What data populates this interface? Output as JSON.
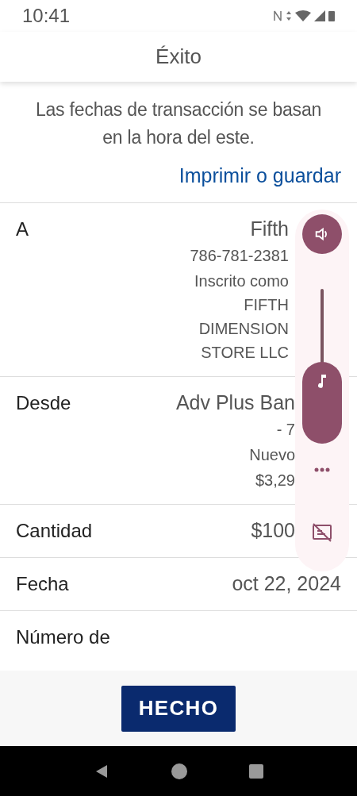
{
  "status_bar": {
    "time": "10:41"
  },
  "header": {
    "title": "Éxito"
  },
  "note": "Las fechas de transacción se basan en la hora del este.",
  "print_link": "Imprimir o guardar",
  "details": [
    {
      "label": "A",
      "value": "Fifth",
      "lines": [
        "786-781-2381",
        "Inscrito como FIFTH DIMENSION STORE LLC"
      ]
    },
    {
      "label": "Desde",
      "value": "Adv Plus Ban",
      "lines": [
        "- 7",
        "Nuevo",
        "$3,29"
      ]
    },
    {
      "label": "Cantidad",
      "value": "$100"
    },
    {
      "label": "Fecha",
      "value": "oct 22, 2024"
    },
    {
      "label": "Número de"
    }
  ],
  "done_button": "HECHO",
  "volume_panel": {
    "level": 0.5
  }
}
